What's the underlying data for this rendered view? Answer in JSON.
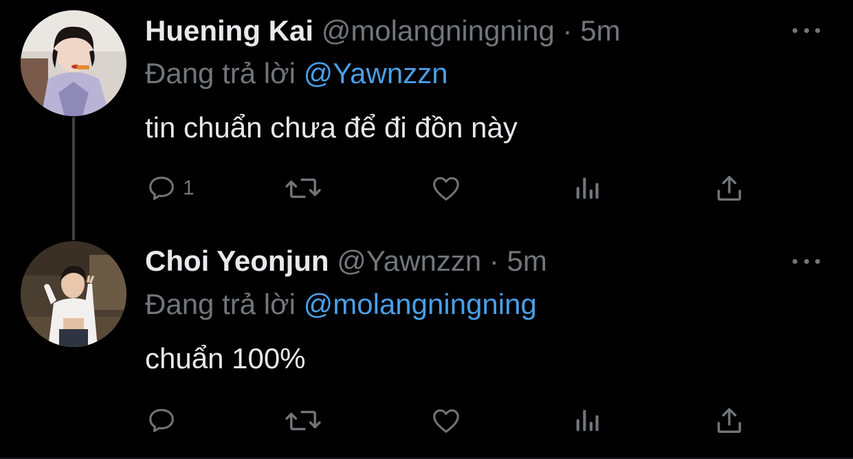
{
  "tweets": [
    {
      "author_name": "Huening Kai",
      "handle": "@molangningning",
      "separator": "·",
      "time": "5m",
      "reply_prefix": "Đang trả lời",
      "reply_mention": "@Yawnzzn",
      "text": "tin chuẩn chưa để đi đồn này",
      "reply_count": "1",
      "avatar_icon": "avatar-photo"
    },
    {
      "author_name": "Choi Yeonjun",
      "handle": "@Yawnzzn",
      "separator": "·",
      "time": "5m",
      "reply_prefix": "Đang trả lời",
      "reply_mention": "@molangningning",
      "text": "chuẩn 100%",
      "reply_count": "",
      "avatar_icon": "avatar-photo"
    }
  ],
  "colors": {
    "background": "#000000",
    "primary_text": "#e7e9ea",
    "secondary_text": "#71767b",
    "mention": "#4a9fe6"
  }
}
